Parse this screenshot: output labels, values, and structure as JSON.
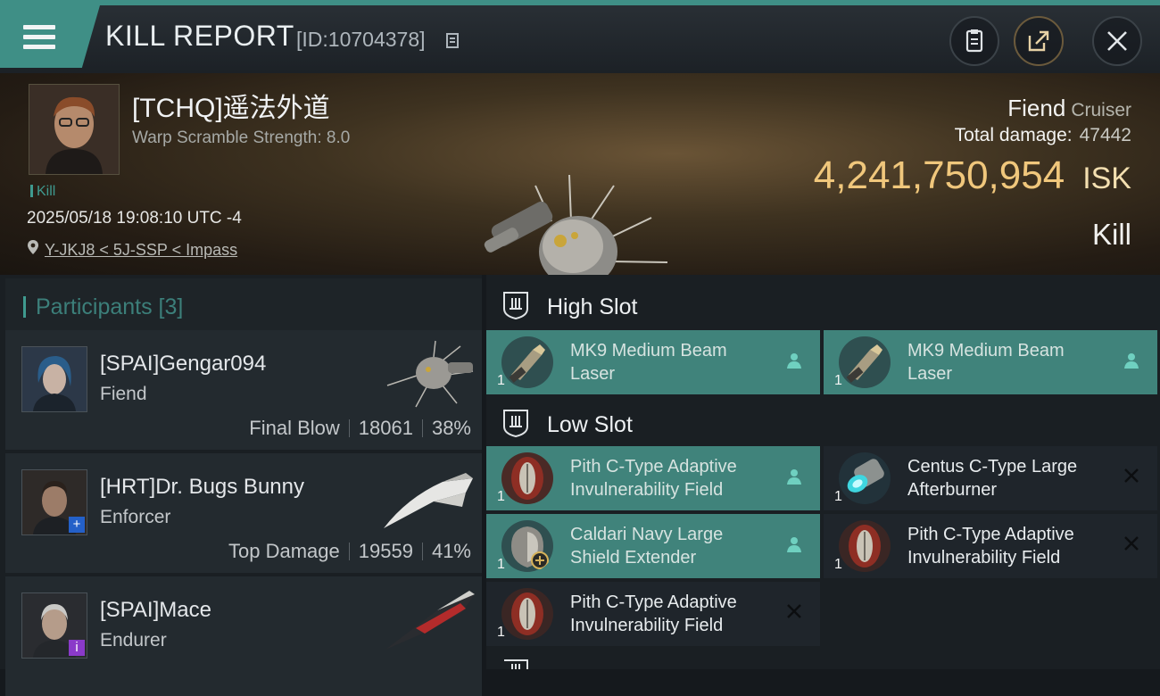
{
  "header": {
    "title": "KILL REPORT",
    "report_id": "[ID:10704378]"
  },
  "victim": {
    "name": "[TCHQ]遥法外道",
    "warp_scramble": "Warp Scramble Strength: 8.0",
    "tag": "Kill",
    "datetime": "2025/05/18 19:08:10 UTC -4",
    "location": "Y-JKJ8 < 5J-SSP < Impass",
    "ship_name": "Fiend",
    "ship_class": "Cruiser",
    "total_damage_label": "Total damage:",
    "total_damage": "47442",
    "isk_value": "4,241,750,954",
    "isk_unit": "ISK",
    "result": "Kill"
  },
  "participants": {
    "title": "Participants [3]",
    "items": [
      {
        "name": "[SPAI]Gengar094",
        "ship": "Fiend",
        "role": "Final Blow",
        "damage": "18061",
        "percent": "38%",
        "badge": ""
      },
      {
        "name": "[HRT]Dr. Bugs Bunny",
        "ship": "Enforcer",
        "role": "Top Damage",
        "damage": "19559",
        "percent": "41%",
        "badge": "+"
      },
      {
        "name": "[SPAI]Mace",
        "ship": "Endurer",
        "role": "",
        "damage": "",
        "percent": "",
        "badge": "i"
      }
    ]
  },
  "slots": {
    "high": {
      "title": "High Slot",
      "modules": [
        {
          "name": "MK9 Medium Beam Laser",
          "qty": "1",
          "state": "fitted"
        },
        {
          "name": "MK9 Medium Beam Laser",
          "qty": "1",
          "state": "fitted"
        }
      ]
    },
    "low": {
      "title": "Low Slot",
      "modules": [
        {
          "name": "Pith C-Type Adaptive Invulnerability Field",
          "qty": "1",
          "state": "fitted"
        },
        {
          "name": "Centus C-Type Large Afterburner",
          "qty": "1",
          "state": "destroyed"
        },
        {
          "name": "Caldari Navy Large Shield Extender",
          "qty": "1",
          "state": "fitted"
        },
        {
          "name": "Pith C-Type Adaptive Invulnerability Field",
          "qty": "1",
          "state": "destroyed"
        },
        {
          "name": "Pith C-Type Adaptive Invulnerability Field",
          "qty": "1",
          "state": "destroyed"
        }
      ]
    }
  },
  "colors": {
    "accent": "#3f8f86",
    "isk": "#f0c77c",
    "fitted": "#40837b"
  }
}
